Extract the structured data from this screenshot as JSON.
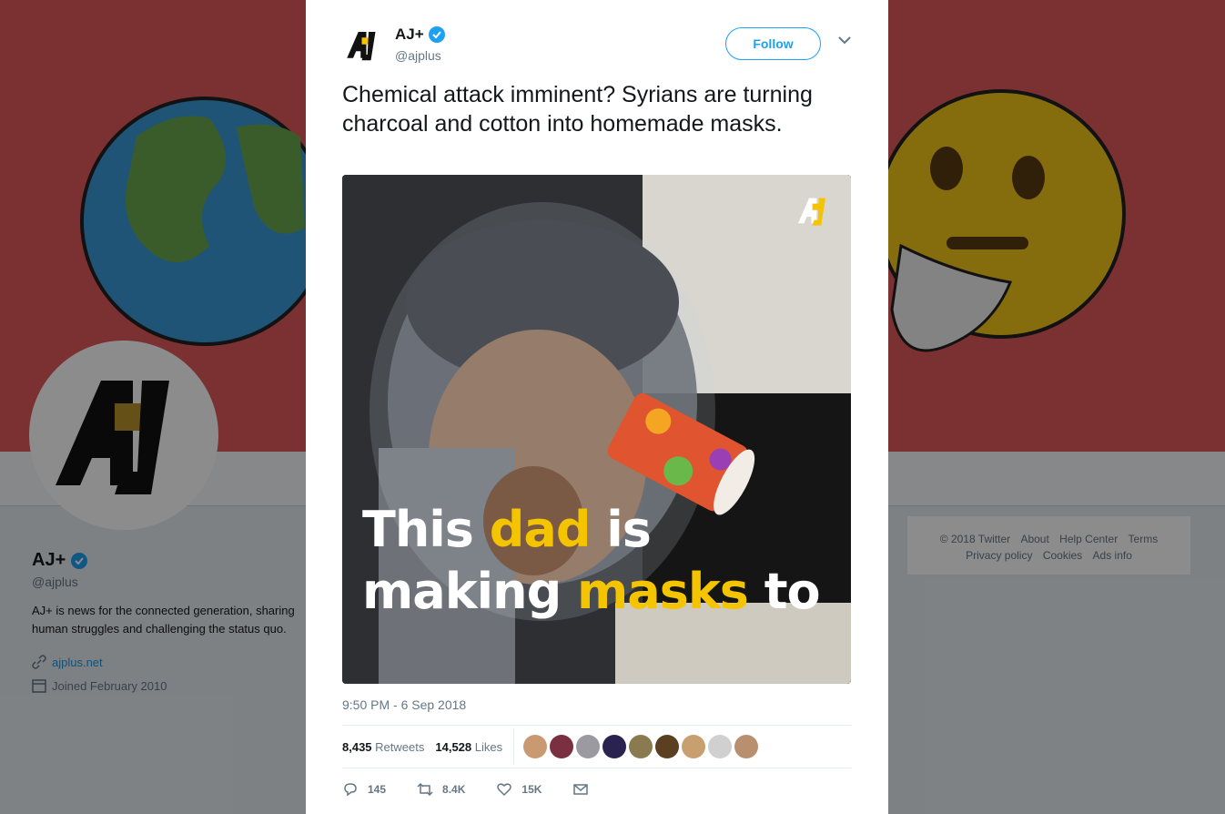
{
  "profile": {
    "name": "AJ+",
    "handle": "@ajplus",
    "bio": "AJ+ is news for the connected generation, sharing human struggles and challenging the status quo.",
    "website": "ajplus.net",
    "joined": "Joined February 2010"
  },
  "footer": {
    "copyright": "© 2018 Twitter",
    "about": "About",
    "help_center": "Help Center",
    "terms": "Terms",
    "privacy": "Privacy policy",
    "cookies": "Cookies",
    "ads_info": "Ads info"
  },
  "tweet": {
    "author_name": "AJ+",
    "author_handle": "@ajplus",
    "follow_label": "Follow",
    "text": "Chemical attack imminent? Syrians are turning charcoal and cotton into homemade masks.",
    "caption": {
      "line1_a": "This ",
      "line1_b": "dad",
      "line1_c": " is",
      "line2_a": "making ",
      "line2_b": "masks",
      "line2_c": " to"
    },
    "timestamp": "9:50 PM - 6 Sep 2018",
    "retweets_count": "8,435",
    "retweets_label": "Retweets",
    "likes_count": "14,528",
    "likes_label": "Likes",
    "reply_count": "145",
    "retweet_action_count": "8.4K",
    "like_action_count": "15K"
  },
  "colors": {
    "banner": "#e05a5a",
    "brand_yellow": "#f5c400",
    "link_blue": "#1b95e0",
    "follow_blue": "#1da1f2"
  }
}
